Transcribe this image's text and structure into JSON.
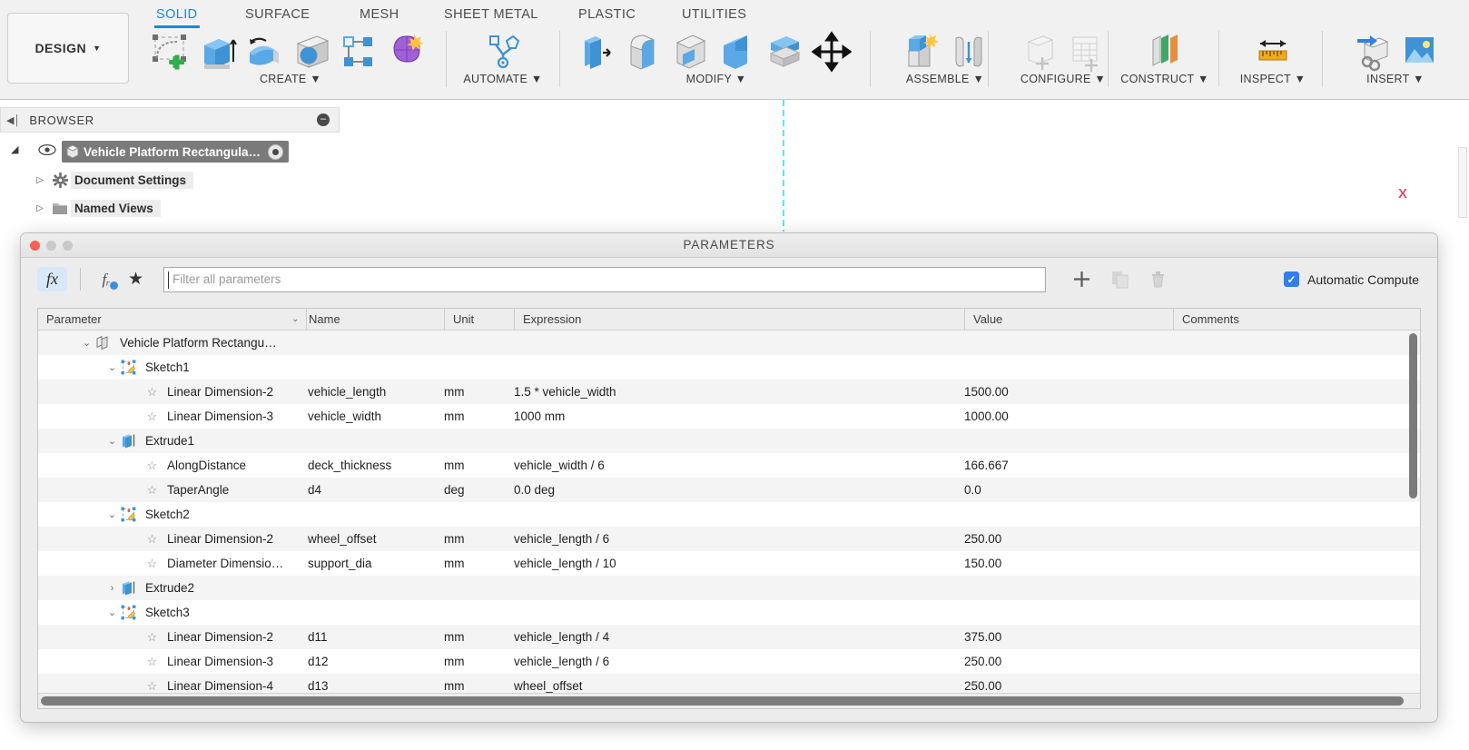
{
  "ribbon": {
    "design_button": "DESIGN",
    "design_caret": "▼",
    "tabs": [
      {
        "label": "SOLID",
        "active": true
      },
      {
        "label": "SURFACE",
        "active": false
      },
      {
        "label": "MESH",
        "active": false
      },
      {
        "label": "SHEET METAL",
        "active": false
      },
      {
        "label": "PLASTIC",
        "active": false
      },
      {
        "label": "UTILITIES",
        "active": false
      }
    ],
    "groups": [
      {
        "label": "CREATE",
        "caret": "▼"
      },
      {
        "label": "AUTOMATE",
        "caret": "▼"
      },
      {
        "label": "MODIFY",
        "caret": "▼"
      },
      {
        "label": "ASSEMBLE",
        "caret": "▼"
      },
      {
        "label": "CONFIGURE",
        "caret": "▼"
      },
      {
        "label": "CONSTRUCT",
        "caret": "▼"
      },
      {
        "label": "INSPECT",
        "caret": "▼"
      },
      {
        "label": "INSERT",
        "caret": "▼"
      }
    ]
  },
  "browser": {
    "title": "BROWSER",
    "collapse_icon": "◀│",
    "minimize_icon": "–",
    "nodes": [
      {
        "label": "Vehicle Platform Rectangula…",
        "selected": true
      },
      {
        "label": "Document Settings",
        "selected": false
      },
      {
        "label": "Named Views",
        "selected": false
      }
    ]
  },
  "canvas": {
    "axis_label_x": "X"
  },
  "dialog": {
    "title": "PARAMETERS",
    "traffic_colors": [
      "#fb5f57",
      "#c9c9c9",
      "#c9c9c9"
    ],
    "toolbar": {
      "fx_label": "fx",
      "user_param_label": "fᵣ",
      "favorite_label": "★",
      "add_label": "+",
      "duplicate_label": "duplicate-icon",
      "delete_label": "delete-icon",
      "auto_compute_label": "Automatic Compute",
      "auto_compute_checked": true,
      "check_glyph": "✓"
    },
    "filter": {
      "placeholder": "Filter all parameters",
      "value": ""
    },
    "table": {
      "columns": [
        {
          "key": "parameter",
          "label": "Parameter",
          "sortable": true,
          "sort_caret": "⌄"
        },
        {
          "key": "name",
          "label": "Name"
        },
        {
          "key": "unit",
          "label": "Unit"
        },
        {
          "key": "expression",
          "label": "Expression"
        },
        {
          "key": "value",
          "label": "Value"
        },
        {
          "key": "comments",
          "label": "Comments"
        }
      ],
      "rows": [
        {
          "kind": "root",
          "indent": 1,
          "twisty": "⌄",
          "icon": "component-icon",
          "parameter": "Vehicle Platform Rectangu…",
          "name": "",
          "unit": "",
          "expression": "",
          "value": "",
          "comments": ""
        },
        {
          "kind": "group",
          "indent": 2,
          "twisty": "⌄",
          "icon": "sketch-icon",
          "parameter": "Sketch1",
          "name": "",
          "unit": "",
          "expression": "",
          "value": "",
          "comments": ""
        },
        {
          "kind": "param",
          "indent": 3,
          "twisty": "",
          "icon": "star-icon",
          "parameter": "Linear Dimension-2",
          "name": "vehicle_length",
          "unit": "mm",
          "expression": "1.5 * vehicle_width",
          "value": "1500.00",
          "comments": ""
        },
        {
          "kind": "param",
          "indent": 3,
          "twisty": "",
          "icon": "star-icon",
          "parameter": "Linear Dimension-3",
          "name": "vehicle_width",
          "unit": "mm",
          "expression": "1000 mm",
          "value": "1000.00",
          "comments": ""
        },
        {
          "kind": "group",
          "indent": 2,
          "twisty": "⌄",
          "icon": "extrude-icon",
          "parameter": "Extrude1",
          "name": "",
          "unit": "",
          "expression": "",
          "value": "",
          "comments": ""
        },
        {
          "kind": "param",
          "indent": 3,
          "twisty": "",
          "icon": "star-icon",
          "parameter": "AlongDistance",
          "name": "deck_thickness",
          "unit": "mm",
          "expression": "vehicle_width / 6",
          "value": "166.667",
          "comments": ""
        },
        {
          "kind": "param",
          "indent": 3,
          "twisty": "",
          "icon": "star-icon",
          "parameter": "TaperAngle",
          "name": "d4",
          "unit": "deg",
          "expression": "0.0 deg",
          "value": "0.0",
          "comments": ""
        },
        {
          "kind": "group",
          "indent": 2,
          "twisty": "⌄",
          "icon": "sketch-icon",
          "parameter": "Sketch2",
          "name": "",
          "unit": "",
          "expression": "",
          "value": "",
          "comments": ""
        },
        {
          "kind": "param",
          "indent": 3,
          "twisty": "",
          "icon": "star-icon",
          "parameter": "Linear Dimension-2",
          "name": "wheel_offset",
          "unit": "mm",
          "expression": "vehicle_length / 6",
          "value": "250.00",
          "comments": ""
        },
        {
          "kind": "param",
          "indent": 3,
          "twisty": "",
          "icon": "star-icon",
          "parameter": "Diameter Dimensio…",
          "name": "support_dia",
          "unit": "mm",
          "expression": "vehicle_length / 10",
          "value": "150.00",
          "comments": ""
        },
        {
          "kind": "group",
          "indent": 2,
          "twisty": "›",
          "icon": "extrude-icon",
          "parameter": "Extrude2",
          "name": "",
          "unit": "",
          "expression": "",
          "value": "",
          "comments": ""
        },
        {
          "kind": "group",
          "indent": 2,
          "twisty": "⌄",
          "icon": "sketch-icon",
          "parameter": "Sketch3",
          "name": "",
          "unit": "",
          "expression": "",
          "value": "",
          "comments": ""
        },
        {
          "kind": "param",
          "indent": 3,
          "twisty": "",
          "icon": "star-icon",
          "parameter": "Linear Dimension-2",
          "name": "d11",
          "unit": "mm",
          "expression": "vehicle_length / 4",
          "value": "375.00",
          "comments": ""
        },
        {
          "kind": "param",
          "indent": 3,
          "twisty": "",
          "icon": "star-icon",
          "parameter": "Linear Dimension-3",
          "name": "d12",
          "unit": "mm",
          "expression": "vehicle_length / 6",
          "value": "250.00",
          "comments": ""
        },
        {
          "kind": "param",
          "indent": 3,
          "twisty": "",
          "icon": "star-icon",
          "parameter": "Linear Dimension-4",
          "name": "d13",
          "unit": "mm",
          "expression": "wheel_offset",
          "value": "250.00",
          "comments": ""
        }
      ]
    }
  },
  "colors": {
    "accent_blue": "#1b8ad1",
    "checkbox_blue": "#2f7ff0",
    "axis_cyan": "#5fe3ef",
    "axis_red": "#d9536f",
    "selection_gray": "#7a7a7a"
  }
}
